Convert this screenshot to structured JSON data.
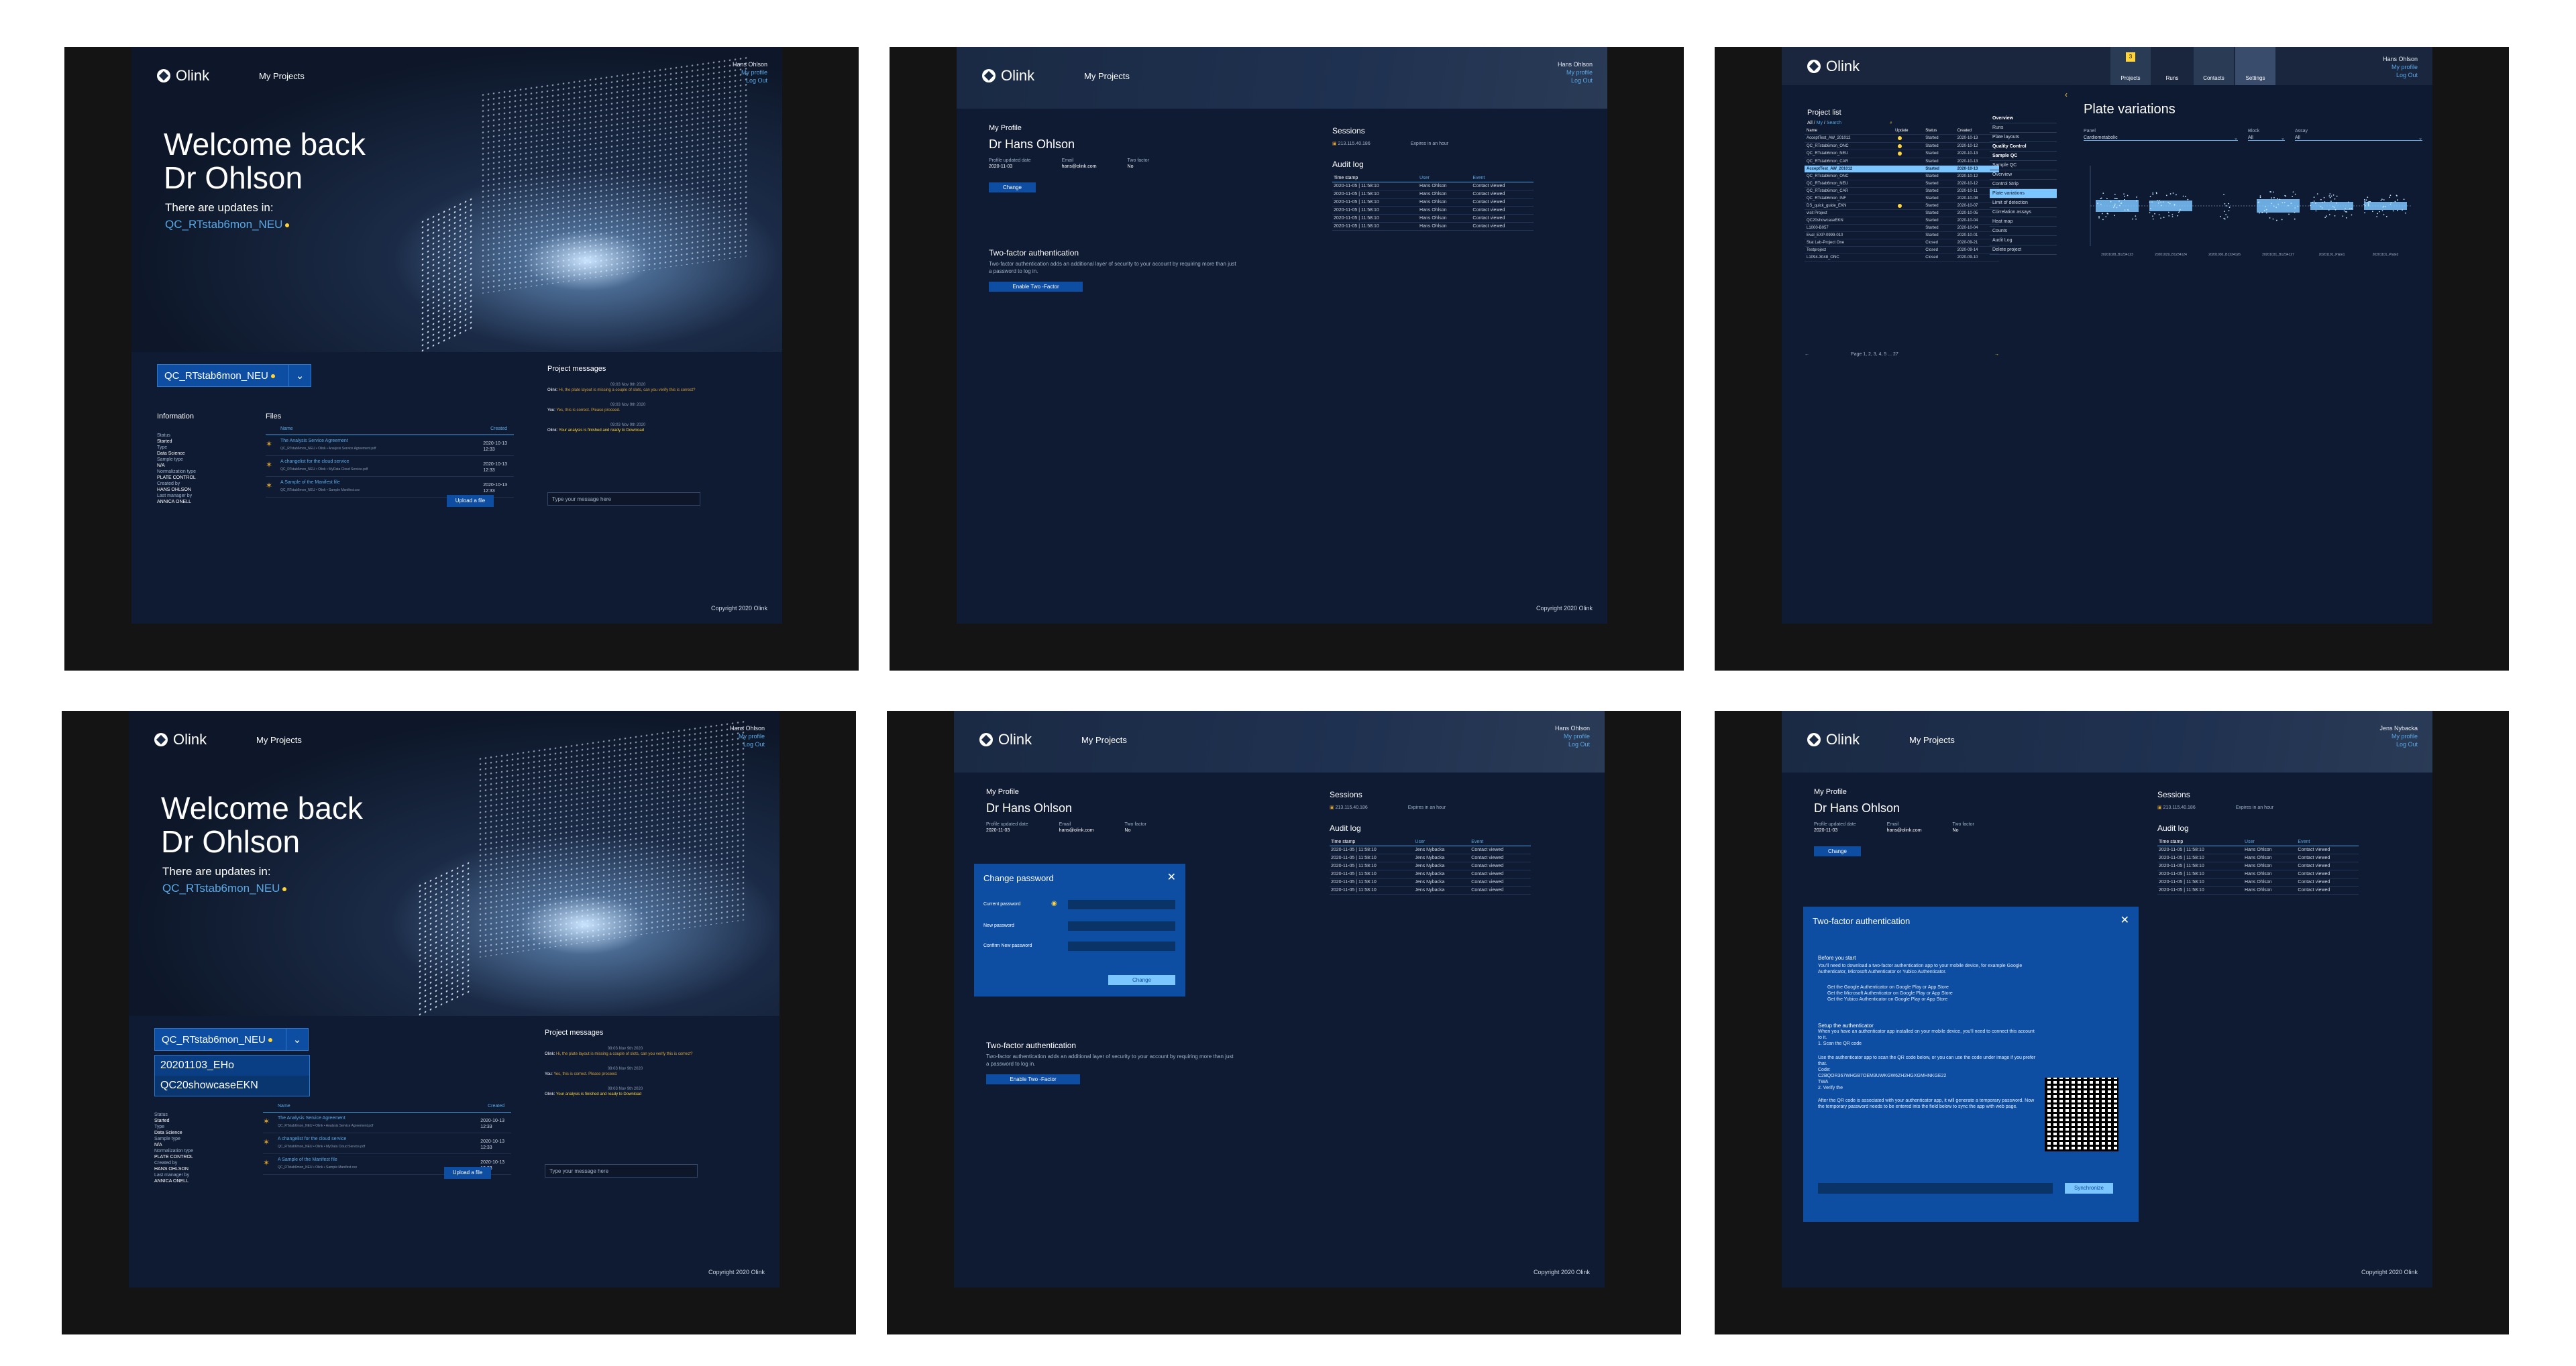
{
  "brand": "Olink",
  "nav_projects": "My Projects",
  "copyright": "Copyright 2020 Olink",
  "user": {
    "name_a": "Hans Ohlson",
    "name_b": "Jens Nybacka",
    "my_profile": "My profile",
    "log_out": "Log Out"
  },
  "home": {
    "welcome_line1": "Welcome back",
    "welcome_line2": "Dr Ohlson",
    "updates_text": "There are updates in:",
    "updates_link": "QC_RTstab6mon_NEU",
    "project_select": "QC_RTstab6mon_NEU",
    "dropdown_options": [
      "20201103_EHo",
      "QC20showcaseEKN"
    ],
    "information_title": "Information",
    "files_title": "Files",
    "info_fields": [
      {
        "label": "Status",
        "value": "Started"
      },
      {
        "label": "Type",
        "value": "Data Science"
      },
      {
        "label": "Sample type",
        "value": "N/A"
      },
      {
        "label": "Normalization type",
        "value": "PLATE CONTROL"
      },
      {
        "label": "Created by",
        "value": "HANS OHLSON"
      },
      {
        "label": "Last manager by",
        "value": "ANNICA ONELL"
      }
    ],
    "files_cols": {
      "name": "Name",
      "created": "Created"
    },
    "files": [
      {
        "title": "The Analysis Service Agreement",
        "sub": "QC_RTstab6mon_NEU • Olink • Analysis Service Agreement.pdf",
        "date": "2020-10-13",
        "time": "12:33"
      },
      {
        "title": "A changelist for the cloud service",
        "sub": "QC_RTstab6mon_NEU • Olink • MyData Cloud Service.pdf",
        "date": "2020-10-13",
        "time": "12:33"
      },
      {
        "title": "A Sample of the Manifest file",
        "sub": "QC_RTstab6mon_NEU • Olink • Sample Manifest.csv",
        "date": "2020-10-13",
        "time": "12:33"
      }
    ],
    "upload_label": "Upload a file",
    "messages_title": "Project messages",
    "messages": [
      {
        "time": "09:03 Nov 9th 2020",
        "who": "Olink:",
        "text": "Hi, the plate layout is missing a couple of slots, can you verify this is correct?"
      },
      {
        "time": "09:03 Nov 9th 2020",
        "who": "You:",
        "text": "Yes, this is correct. Please proceed."
      },
      {
        "time": "09:03 Nov 9th 2020",
        "who": "Olink:",
        "text": "Your analysis is finished and ready to Download"
      }
    ],
    "message_placeholder": "Type your message here"
  },
  "profile": {
    "title": "My Profile",
    "name": "Dr Hans Ohlson",
    "fields": [
      {
        "label": "Profile updated date",
        "value": "2020-11-03"
      },
      {
        "label": "Email",
        "value": "hans@olink.com"
      },
      {
        "label": "Two factor",
        "value": "No"
      }
    ],
    "change_label": "Change",
    "twofa_title": "Two-factor authentication",
    "twofa_text": "Two-factor authentication adds an additional layer of security to your account by requiring more than just a password to log in.",
    "enable_label": "Enable Two -Factor",
    "sessions_title": "Sessions",
    "session_ip": "213.115.40.186",
    "session_expires": "Expires in an hour",
    "audit_title": "Audit log",
    "audit_cols": [
      "Time stamp",
      "User",
      "Event"
    ],
    "audit_rows": [
      [
        "2020-11-05 | 11:58:10",
        "Hans Ohlson",
        "Contact viewed"
      ],
      [
        "2020-11-05 | 11:58:10",
        "Hans Ohlson",
        "Contact viewed"
      ],
      [
        "2020-11-05 | 11:58:10",
        "Hans Ohlson",
        "Contact viewed"
      ],
      [
        "2020-11-05 | 11:58:10",
        "Hans Ohlson",
        "Contact viewed"
      ],
      [
        "2020-11-05 | 11:58:10",
        "Hans Ohlson",
        "Contact viewed"
      ],
      [
        "2020-11-05 | 11:58:10",
        "Hans Ohlson",
        "Contact viewed"
      ]
    ],
    "audit_rows_b": [
      [
        "2020-11-05 | 11:58:10",
        "Jens Nybacka",
        "Contact viewed"
      ],
      [
        "2020-11-05 | 11:58:10",
        "Jens Nybacka",
        "Contact viewed"
      ],
      [
        "2020-11-05 | 11:58:10",
        "Jens Nybacka",
        "Contact viewed"
      ],
      [
        "2020-11-05 | 11:58:10",
        "Jens Nybacka",
        "Contact viewed"
      ],
      [
        "2020-11-05 | 11:58:10",
        "Jens Nybacka",
        "Contact viewed"
      ],
      [
        "2020-11-05 | 11:58:10",
        "Jens Nybacka",
        "Contact viewed"
      ]
    ]
  },
  "change_password": {
    "title": "Change password",
    "current": "Current password",
    "new": "New password",
    "confirm": "Confirm New password",
    "submit": "Change"
  },
  "twofa_modal": {
    "title": "Two-factor authentication",
    "before_title": "Before you start",
    "before_text": "You'll need to download a two-factor authentication app to your mobile device, for example Google Authenticator, Microsoft Authenticator or Yubico Authenticator.",
    "apps": [
      "Get the Google Authenticator on Google Play or App Store",
      "Get the Microsoft Authenticator on Google Play or App Store",
      "Get the Yubico Authenticator on Google Play or App Store"
    ],
    "setup_title": "Setup the authenticator",
    "setup_text": "When you have an authenticator app installed on your mobile device, you'll need to connect this account to it.",
    "step1": "1. Scan the QR code",
    "step1_text": "Use the authenticator app to scan the QR code below, or you can use the code under image if you prefer that.",
    "code_label": "Code:",
    "code": "C2BQOR367WHGB7OEM3UWKGW6ZH2HGXGMHNKGE22",
    "code_end": "TWA",
    "step2": "2. Verify the",
    "step2_text": "After the QR code is associated with your authenticator app, it will generate a temporary password. Now the temporary password needs to be entered into the field below to sync the app with web page.",
    "sync_label": "Synchronize"
  },
  "plates": {
    "tabs": [
      "Projects",
      "Runs",
      "Contacts",
      "Settings"
    ],
    "badge": "3",
    "project_list_title": "Project list",
    "filter": {
      "all": "All",
      "my": "My",
      "search": "Search"
    },
    "cols": [
      "Name",
      "Update",
      "Status",
      "Created"
    ],
    "rows": [
      [
        "AcceptTest_AW_201012",
        "Started",
        "2020-10-13"
      ],
      [
        "QC_RTstab6mon_ONC",
        "Started",
        "2020-10-12"
      ],
      [
        "QC_RTstab6mon_NEU",
        "Started",
        "2020-10-13"
      ],
      [
        "QC_RTstab6mon_CAR",
        "Started",
        "2020-10-13"
      ],
      [
        "AcceptTest_AW_201012",
        "Started",
        "2020-10-13"
      ],
      [
        "QC_RTstab6mon_ONC",
        "Started",
        "2020-10-12"
      ],
      [
        "QC_RTstab6mon_NEU",
        "Started",
        "2020-10-12"
      ],
      [
        "QC_RTstab6mon_CAR",
        "Started",
        "2020-10-11"
      ],
      [
        "QC_RTstab6mon_INF",
        "Started",
        "2020-10-08"
      ],
      [
        "DS_quick_guide_EKN",
        "Started",
        "2020-10-07"
      ],
      [
        "visit Project",
        "Started",
        "2020-10-05"
      ],
      [
        "QC20showcaseEKN",
        "Started",
        "2020-10-04"
      ],
      [
        "L1000-B057",
        "Started",
        "2020-10-04"
      ],
      [
        "Eval_EXP-0999-010",
        "Started",
        "2020-10-01"
      ],
      [
        "Stat Lab-Project One",
        "Closed",
        "2020-09-21"
      ],
      [
        "Testproject",
        "Closed",
        "2020-09-14"
      ],
      [
        "L1094-3048_ONC",
        "Closed",
        "2020-09-10"
      ]
    ],
    "pager": "Page 1, 2, 3, 4, 5 ... 27",
    "menu": [
      "Overview",
      "Runs",
      "Plate layouts",
      "Quality Control",
      "Sample QC",
      "Sample QC",
      "Overview",
      "Control Strip",
      "Plate variations",
      "Limit of detection",
      "Correlation assays",
      "Heat map",
      "Counts",
      "Audit Log",
      "Delete project"
    ],
    "chart_title": "Plate variations",
    "panel_label": "Panel",
    "panel_value": "Cardiometabolic",
    "block_label": "Block",
    "block_value": "All",
    "assay_label": "Assay",
    "assay_value": "All"
  },
  "chart_data": {
    "type": "box",
    "categories": [
      "20201028_B1234123",
      "20201029_B1234124",
      "20201030_B1234126",
      "20201031_B1234127",
      "20201101_Plate1",
      "20201101_Plate2"
    ],
    "series": [
      {
        "values": [
          0.2,
          0.15,
          null,
          0.25,
          0.05,
          0.05
        ]
      }
    ]
  }
}
